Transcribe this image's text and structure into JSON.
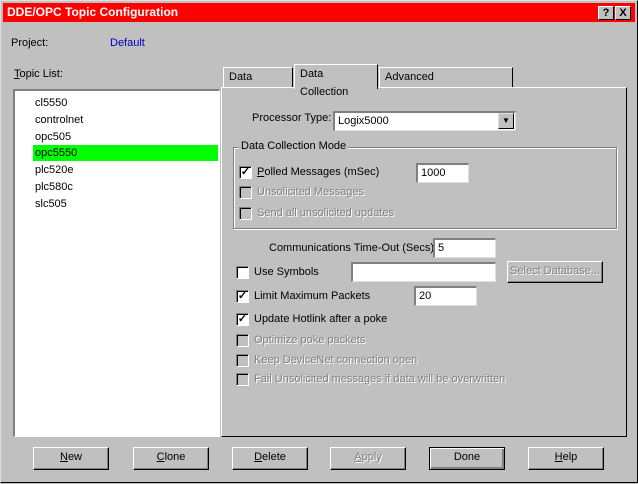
{
  "window": {
    "title": "DDE/OPC Topic Configuration",
    "help_button": "?",
    "close_button": "X"
  },
  "project": {
    "label": "Project:",
    "value": "Default"
  },
  "topic_list": {
    "label": "Topic List:",
    "items": [
      {
        "label": "cl5550",
        "selected": false
      },
      {
        "label": "controlnet",
        "selected": false
      },
      {
        "label": "opc505",
        "selected": false
      },
      {
        "label": "opc5550",
        "selected": true
      },
      {
        "label": "plc520e",
        "selected": false
      },
      {
        "label": "plc580c",
        "selected": false
      },
      {
        "label": "slc505",
        "selected": false
      }
    ]
  },
  "tabs": [
    {
      "label": "Data Source",
      "active": false
    },
    {
      "label": "Data Collection",
      "active": true
    },
    {
      "label": "Advanced Communication",
      "active": false
    }
  ],
  "data_collection": {
    "processor_type_label": "Processor Type:",
    "processor_type_value": "Logix5000",
    "mode_group_label": "Data Collection Mode",
    "polled_label": "Polled Messages (mSec)",
    "polled_checked": true,
    "polled_value": "1000",
    "unsolicited_label": "Unsolicited Messages",
    "unsolicited_enabled": false,
    "send_unsolicited_label": "Send all unsolicited updates",
    "send_unsolicited_enabled": false,
    "timeout_label": "Communications Time-Out (Secs):",
    "timeout_value": "5",
    "use_symbols_label": "Use Symbols",
    "use_symbols_checked": false,
    "use_symbols_value": "",
    "select_database_label": "Select Database...",
    "limit_packets_label": "Limit Maximum Packets",
    "limit_packets_checked": true,
    "limit_packets_value": "20",
    "update_hotlink_label": "Update Hotlink after a poke",
    "update_hotlink_checked": true,
    "optimize_poke_label": "Optimize poke packets",
    "keep_devicenet_label": "Keep DeviceNet connection open",
    "fail_unsolicited_label": "Fail Unsolicited messages if data will be overwritten"
  },
  "buttons": {
    "new": "New",
    "clone": "Clone",
    "delete": "Delete",
    "apply": "Apply",
    "done": "Done",
    "help": "Help"
  },
  "colors": {
    "title_bar": "#ff0000",
    "selection": "#00ff00",
    "project_value": "#0000c0",
    "face": "#c0c0c0"
  }
}
